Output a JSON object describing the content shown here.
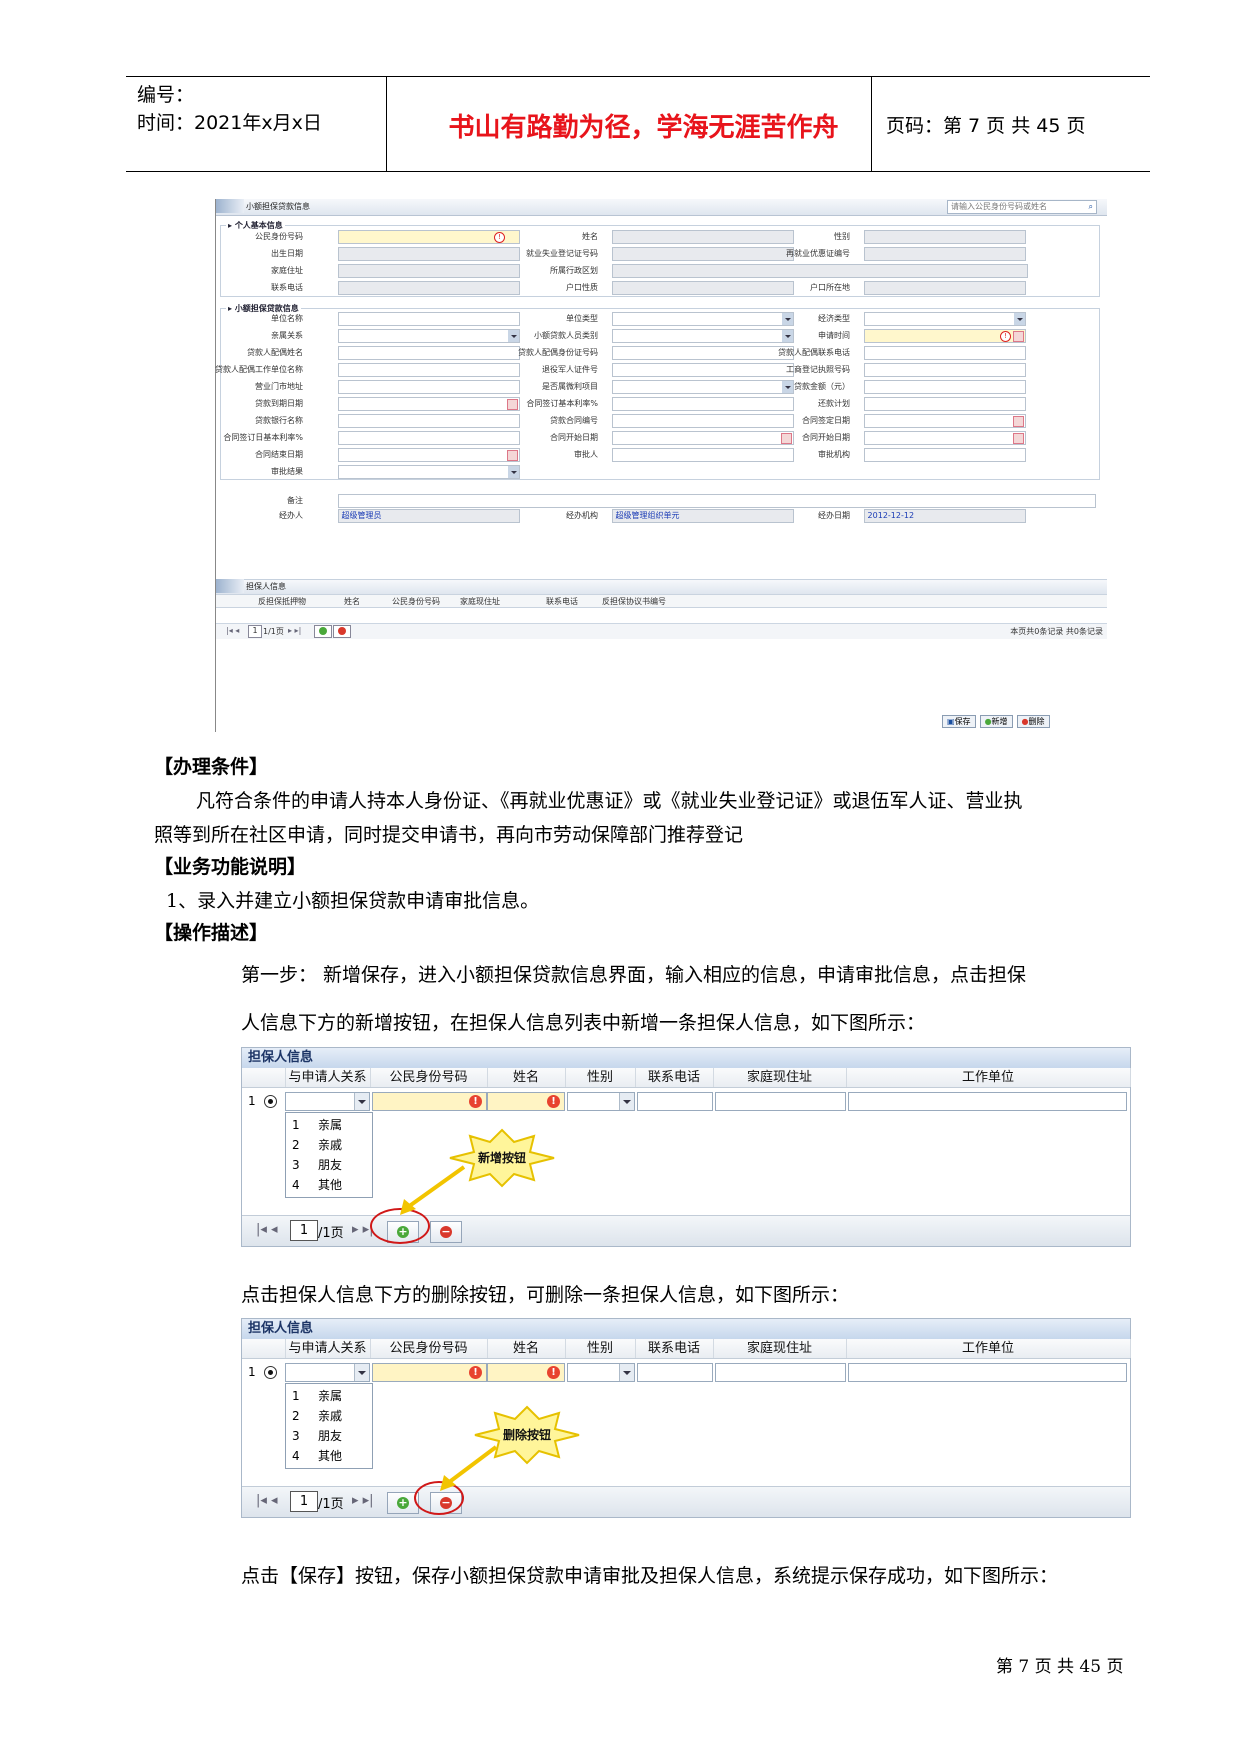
{
  "header": {
    "code_label": "编号：",
    "time_label": "时间：2021年x月x日",
    "motto": "书山有路勤为径，学海无涯苦作舟",
    "page_label": "页码：第 7 页  共 45 页"
  },
  "shot1": {
    "tab_title": "小额担保贷款信息",
    "search_placeholder": "请输入公民身份号码或姓名",
    "section_basic": "个人基本信息",
    "section_loan": "小额担保贷款信息",
    "basic_fields": [
      {
        "l1": "公民身份号码",
        "l2": "姓名",
        "l3": "性别"
      },
      {
        "l1": "出生日期",
        "l2": "就业失业登记证号码",
        "l3": "再就业优惠证编号"
      },
      {
        "l1": "家庭住址",
        "l2": "所属行政区划",
        "l3": ""
      },
      {
        "l1": "联系电话",
        "l2": "户口性质",
        "l3": "户口所在地"
      }
    ],
    "loan_fields": [
      {
        "l1": "单位名称",
        "l2": "单位类型",
        "l3": "经济类型"
      },
      {
        "l1": "亲属关系",
        "l2": "小额贷款人员类别",
        "l3": "申请时间"
      },
      {
        "l1": "贷款人配偶姓名",
        "l2": "贷款人配偶身份证号码",
        "l3": "贷款人配偶联系电话"
      },
      {
        "l1": "贷款人配偶工作单位名称",
        "l2": "退役军人证件号",
        "l3": "工商登记执照号码"
      },
      {
        "l1": "营业门市地址",
        "l2": "是否属微利项目",
        "l3": "贷款金额（元）"
      },
      {
        "l1": "贷款到期日期",
        "l2": "合同签订基本利率%",
        "l3": "还款计划"
      },
      {
        "l1": "贷款银行名称",
        "l2": "贷款合同编号",
        "l3": "合同签定日期"
      },
      {
        "l1": "合同签订日基本利率%",
        "l2": "合同开始日期",
        "l3": "合同开始日期"
      },
      {
        "l1": "合同结束日期",
        "l2": "审批人",
        "l3": "审批机构"
      },
      {
        "l1": "审批结果",
        "l2": "",
        "l3": ""
      }
    ],
    "remark_label": "备注",
    "handler_label": "经办人",
    "handler_value": "超级管理员",
    "org_label": "经办机构",
    "org_value": "超级管理组织单元",
    "date_label": "经办日期",
    "date_value": "2012-12-12",
    "guarantor_tab": "担保人信息",
    "grid_columns": [
      "反担保抵押物",
      "姓名",
      "公民身份号码",
      "家庭现住址",
      "联系电话",
      "反担保协议书编号"
    ],
    "pager_text": "1/1页",
    "pager_page": "1",
    "records_text": "本页共0条记录 共0条记录",
    "btn_save": "保存",
    "btn_add": "新增",
    "btn_delete": "删除"
  },
  "body": {
    "h_conditions": "【办理条件】",
    "p_conditions_1": "凡符合条件的申请人持本人身份证、《再就业优惠证》或《就业失业登记证》或退伍军人证、营业执",
    "p_conditions_2": "照等到所在社区申请，同时提交申请书，再向市劳动保障部门推荐登记",
    "h_function": "【业务功能说明】",
    "p_function": "1、录入并建立小额担保贷款申请审批信息。",
    "h_ops": "【操作描述】",
    "p_step1_a": "第一步：    新增保存，进入小额担保贷款信息界面，输入相应的信息，申请审批信息，点击担保",
    "p_step1_b": "人信息下方的新增按钮，在担保人信息列表中新增一条担保人信息，如下图所示：",
    "p_delete": "点击担保人信息下方的删除按钮，可删除一条担保人信息，如下图所示：",
    "p_save": "点击【保存】按钮，保存小额担保贷款申请审批及担保人信息，系统提示保存成功，如下图所示："
  },
  "grid": {
    "title": "担保人信息",
    "columns": [
      "与申请人关系",
      "公民身份号码",
      "姓名",
      "性别",
      "联系电话",
      "家庭现住址",
      "工作单位"
    ],
    "row_number": "1",
    "options": [
      {
        "n": "1",
        "l": "亲属"
      },
      {
        "n": "2",
        "l": "亲戚"
      },
      {
        "n": "3",
        "l": "朋友"
      },
      {
        "n": "4",
        "l": "其他"
      }
    ],
    "pager_page": "1",
    "pager_total": "/1页",
    "callout_add": "新增按钮",
    "callout_delete": "删除按钮"
  },
  "footer": {
    "page_text": "第 7 页 共 45 页"
  }
}
